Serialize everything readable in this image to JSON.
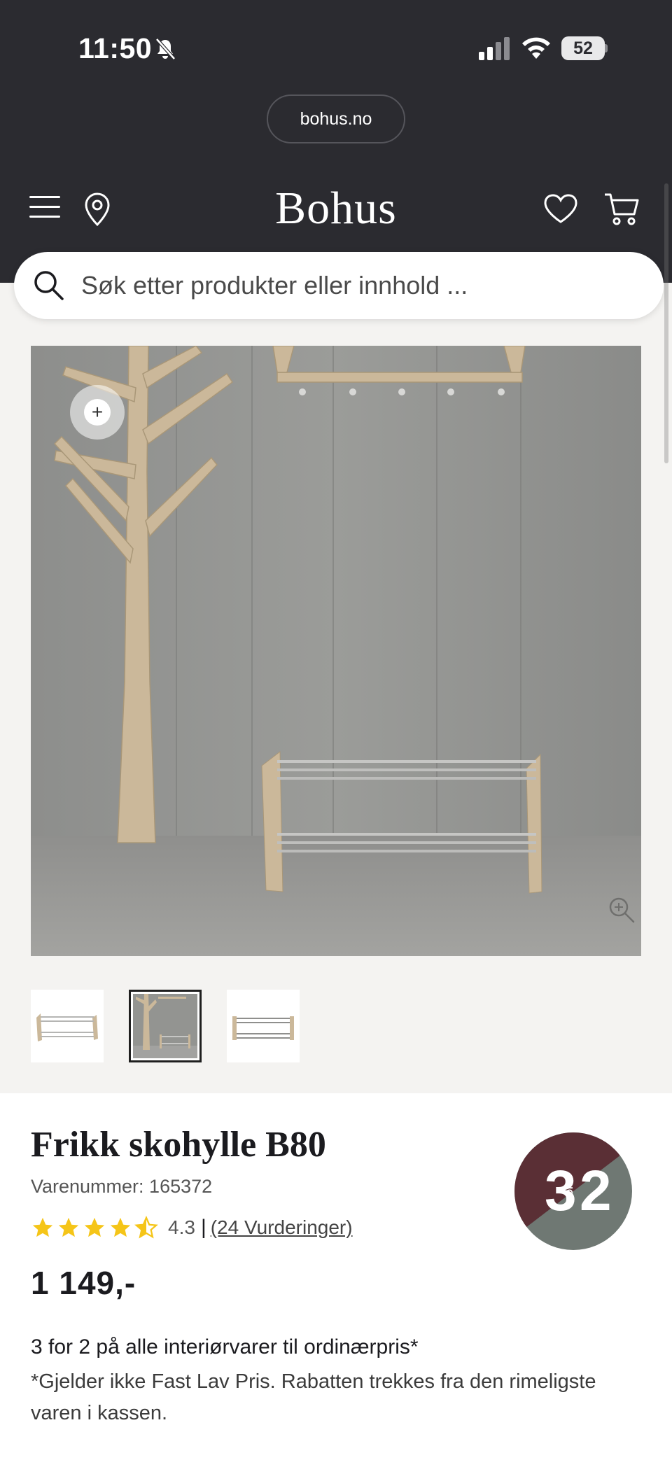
{
  "status_bar": {
    "time": "11:50",
    "battery": "52"
  },
  "browser": {
    "url": "bohus.no"
  },
  "header": {
    "logo": "Bohus"
  },
  "search": {
    "placeholder": "Søk etter produkter eller innhold ..."
  },
  "product": {
    "name": "Frikk skohylle B80",
    "sku_label": "Varenummer: 165372",
    "rating_value": "4.3",
    "rating_stars": 4.3,
    "rating_separator": "|",
    "reviews_link": "(24 Vurderinger)",
    "price": "1 149,-",
    "thumbnail_count": 3,
    "active_thumbnail": 2
  },
  "promo": {
    "title": "3 for 2 på alle interiørvarer til ordinærpris*",
    "note": "*Gjelder ikke Fast Lav Pris. Rabatten trekkes fra den rimeligste varen i kassen.",
    "badge": {
      "left": "3",
      "small": "FOR",
      "right": "2"
    }
  },
  "colors": {
    "header_bg": "#2b2b30",
    "page_bg": "#f4f3f1",
    "star": "#f5c518",
    "badge_left": "#5a2f35",
    "badge_right": "#6f7873"
  },
  "icons": [
    "bell-muted-icon",
    "signal-icon",
    "wifi-icon",
    "menu-icon",
    "location-pin-icon",
    "heart-icon",
    "cart-icon",
    "search-icon",
    "plus-icon",
    "zoom-icon"
  ]
}
